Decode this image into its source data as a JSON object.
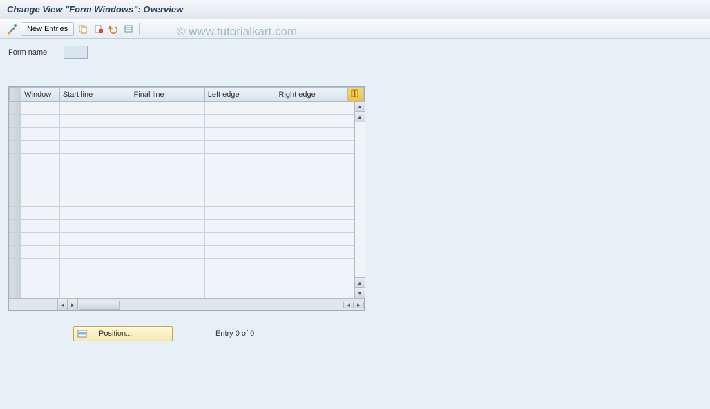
{
  "title": "Change View \"Form Windows\": Overview",
  "watermark": "© www.tutorialkart.com",
  "toolbar": {
    "new_entries_label": "New Entries"
  },
  "form": {
    "name_label": "Form name",
    "name_value": ""
  },
  "table": {
    "headers": {
      "window": "Window",
      "start_line": "Start line",
      "final_line": "Final line",
      "left_edge": "Left edge",
      "right_edge": "Right edge"
    },
    "row_count": 15
  },
  "footer": {
    "position_label": "Position...",
    "entry_text": "Entry 0 of 0"
  }
}
